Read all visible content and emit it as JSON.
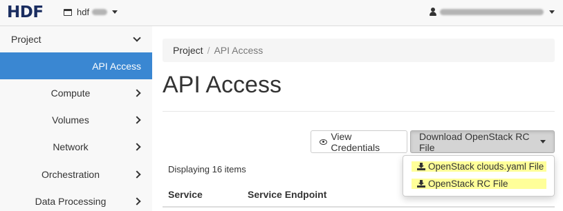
{
  "header": {
    "logo": "HDF",
    "project_switch": {
      "label": "hdf"
    },
    "user_menu": {}
  },
  "sidebar": {
    "section": "Project",
    "active_item": "API Access",
    "items": [
      {
        "label": "Compute"
      },
      {
        "label": "Volumes"
      },
      {
        "label": "Network"
      },
      {
        "label": "Orchestration"
      },
      {
        "label": "Data Processing"
      }
    ]
  },
  "breadcrumb": {
    "root": "Project",
    "separator": "/",
    "current": "API Access"
  },
  "main": {
    "title": "API Access",
    "buttons": {
      "view_credentials": "View Credentials",
      "download_rc": "Download OpenStack RC File"
    },
    "dropdown": {
      "items": [
        {
          "label": "OpenStack clouds.yaml File"
        },
        {
          "label": "OpenStack RC File"
        }
      ]
    },
    "items_count": "Displaying 16 items",
    "table": {
      "columns": [
        "Service",
        "Service Endpoint"
      ]
    }
  },
  "colors": {
    "accent": "#3a87d2",
    "logo": "#1a2d60",
    "highlight": "#ffff99"
  },
  "icons": [
    "project-icon",
    "chevron-down-icon",
    "chevron-right-icon",
    "user-icon",
    "eye-icon",
    "download-icon",
    "caret-down-icon"
  ]
}
